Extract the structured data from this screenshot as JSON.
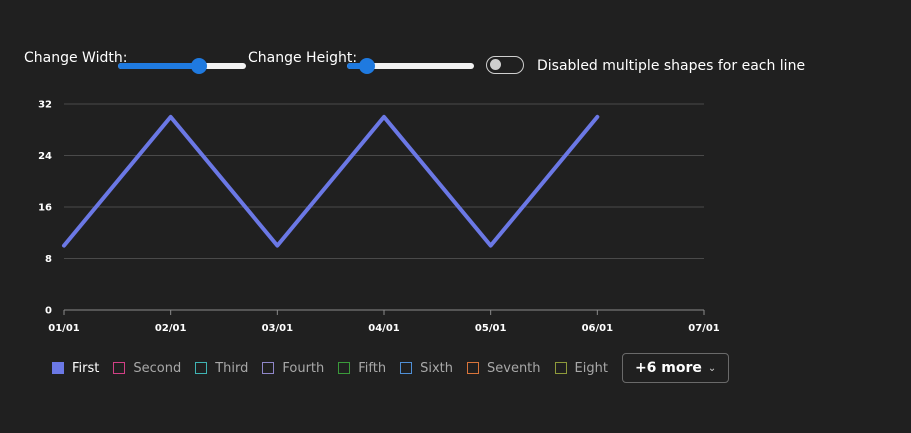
{
  "controls": {
    "width_label": "Change Width:",
    "height_label": "Change Height:",
    "width_value": 0.63,
    "height_value": 0.16,
    "toggle_label": "Disabled multiple shapes for each line",
    "toggle_on": false
  },
  "legend": {
    "more_label": "+6 more",
    "items": [
      {
        "label": "First",
        "color": "#6b78e5",
        "active": true
      },
      {
        "label": "Second",
        "color": "#d13f85",
        "active": false
      },
      {
        "label": "Third",
        "color": "#3fb3b3",
        "active": false
      },
      {
        "label": "Fourth",
        "color": "#8f86c9",
        "active": false
      },
      {
        "label": "Fifth",
        "color": "#3a9a3a",
        "active": false
      },
      {
        "label": "Sixth",
        "color": "#4f8fd6",
        "active": false
      },
      {
        "label": "Seventh",
        "color": "#d9743a",
        "active": false
      },
      {
        "label": "Eight",
        "color": "#8e9a3a",
        "active": false
      }
    ]
  },
  "chart_data": {
    "type": "line",
    "title": "",
    "xlabel": "",
    "ylabel": "",
    "x_ticks": [
      "01/01",
      "02/01",
      "03/01",
      "04/01",
      "05/01",
      "06/01",
      "07/01"
    ],
    "y_ticks": [
      0,
      8,
      16,
      24,
      32
    ],
    "ylim": [
      0,
      32
    ],
    "grid": true,
    "series": [
      {
        "color": "#6b78e5",
        "x": [
          "01/01",
          "02/01",
          "03/01",
          "04/01",
          "05/01",
          "06/01"
        ],
        "values": [
          10,
          30,
          10,
          30,
          10,
          30
        ]
      }
    ]
  }
}
